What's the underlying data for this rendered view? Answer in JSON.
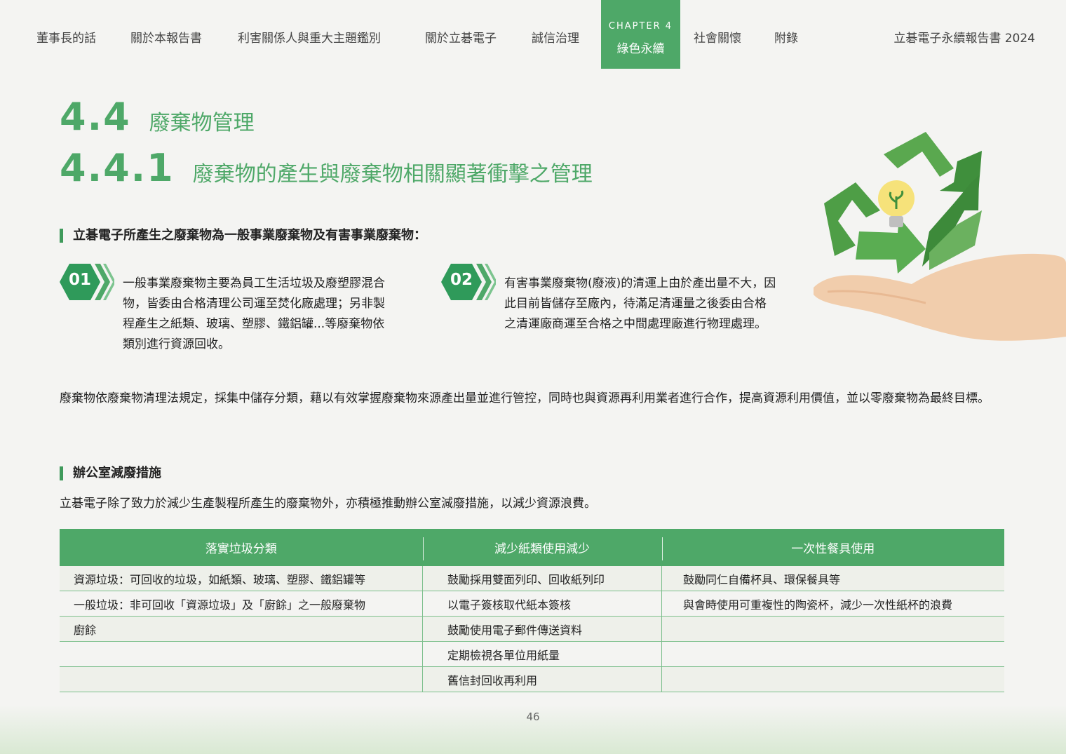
{
  "nav": {
    "items": [
      "董事長的話",
      "關於本報告書",
      "利害關係人與重大主題鑑別",
      "關於立碁電子",
      "誠信治理",
      "社會關懷",
      "附錄"
    ],
    "chapter_label": "CHAPTER 4",
    "chapter_title": "綠色永續",
    "report_title": "立碁電子永續報告書 2024"
  },
  "headings": {
    "h1_num": "4.4",
    "h1_text": "廢棄物管理",
    "h2_num": "4.4.1",
    "h2_text": "廢棄物的產生與廢棄物相關顯著衝擊之管理"
  },
  "intro_label": "立碁電子所產生之廢棄物為一般事業廢棄物及有害事業廢棄物：",
  "items": [
    {
      "num": "01",
      "text": "一般事業廢棄物主要為員工生活垃圾及廢塑膠混合物，皆委由合格清理公司運至焚化廠處理；另非製程產生之紙類、玻璃、塑膠、鐵鋁罐...等廢棄物依類別進行資源回收。"
    },
    {
      "num": "02",
      "text": "有害事業廢棄物(廢液)的清運上由於產出量不大，因此目前皆儲存至廠內，待滿足清運量之後委由合格之清運廠商運至合格之中間處理廠進行物理處理。"
    }
  ],
  "paragraph": "廢棄物依廢棄物清理法規定，採集中儲存分類，藉以有效掌握廢棄物來源產出量並進行管控，同時也與資源再利用業者進行合作，提高資源利用價值，並以零廢棄物為最終目標。",
  "office_label": "辦公室減廢措施",
  "office_paragraph": "立碁電子除了致力於減少生產製程所產生的廢棄物外，亦積極推動辦公室減廢措施，以減少資源浪費。",
  "table": {
    "headers": [
      "落實垃圾分類",
      "減少紙類使用減少",
      "一次性餐具使用"
    ],
    "rows": [
      [
        "資源垃圾：可回收的垃圾，如紙類、玻璃、塑膠、鐵鋁罐等",
        "鼓勵採用雙面列印、回收紙列印",
        "鼓勵同仁自備杯具、環保餐具等"
      ],
      [
        "一般垃圾：非可回收「資源垃圾」及「廚餘」之一般廢棄物",
        "以電子簽核取代紙本簽核",
        "與會時使用可重複性的陶瓷杯，減少一次性紙杯的浪費"
      ],
      [
        "廚餘",
        "鼓勵使用電子郵件傳送資料",
        ""
      ],
      [
        "",
        "定期檢視各單位用紙量",
        ""
      ],
      [
        "",
        "舊信封回收再利用",
        ""
      ]
    ]
  },
  "page_number": "46",
  "colors": {
    "accent": "#4ea868",
    "dark_green": "#3f9a5b"
  }
}
